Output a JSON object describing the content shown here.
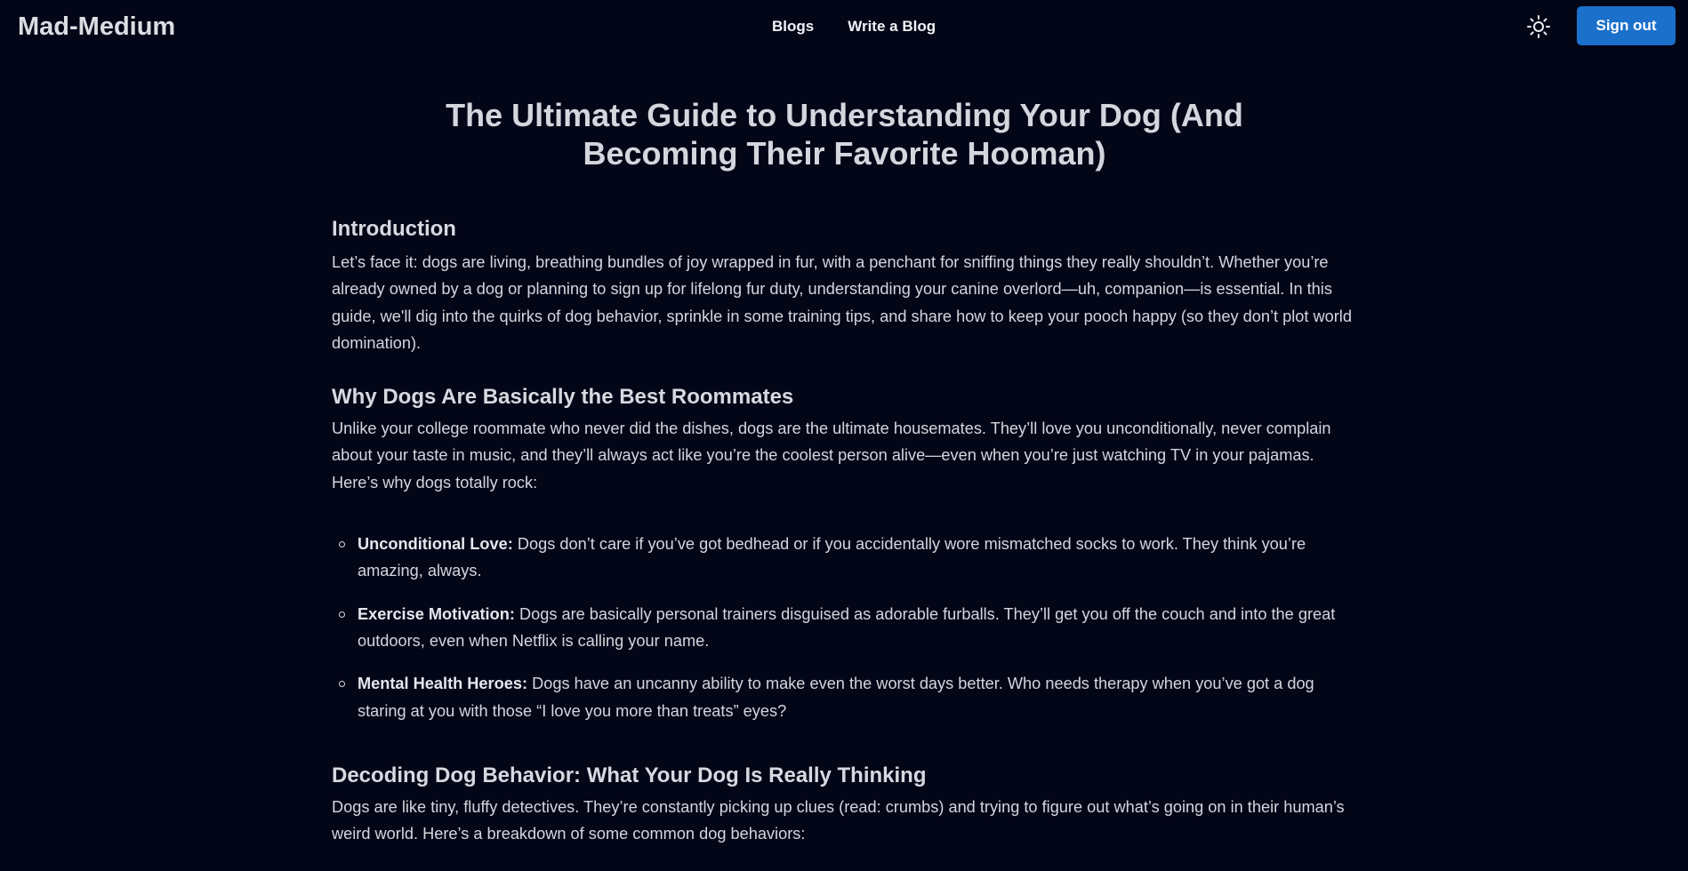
{
  "app": {
    "brand": "Mad-Medium"
  },
  "nav": {
    "links": [
      "Blogs",
      "Write a Blog"
    ],
    "theme_icon": "sun-icon",
    "signout_label": "Sign out"
  },
  "article": {
    "title": "The Ultimate Guide to Understanding Your Dog (And Becoming Their Favorite Hooman)",
    "sections": [
      {
        "heading": "Introduction",
        "paragraph": "Let’s face it: dogs are living, breathing bundles of joy wrapped in fur, with a penchant for sniffing things they really shouldn’t. Whether you’re already owned by a dog or planning to sign up for lifelong fur duty, understanding your canine overlord—uh, companion—is essential. In this guide, we'll dig into the quirks of dog behavior, sprinkle in some training tips, and share how to keep your pooch happy (so they don’t plot world domination)."
      },
      {
        "heading": "Why Dogs Are Basically the Best Roommates",
        "paragraph": "Unlike your college roommate who never did the dishes, dogs are the ultimate housemates. They’ll love you unconditionally, never complain about your taste in music, and they’ll always act like you’re the coolest person alive—even when you’re just watching TV in your pajamas. Here’s why dogs totally rock:",
        "items": [
          {
            "term": "Unconditional Love:",
            "text": "Dogs don’t care if you’ve got bedhead or if you accidentally wore mismatched socks to work. They think you’re amazing, always."
          },
          {
            "term": "Exercise Motivation:",
            "text": "Dogs are basically personal trainers disguised as adorable furballs. They’ll get you off the couch and into the great outdoors, even when Netflix is calling your name."
          },
          {
            "term": "Mental Health Heroes:",
            "text": "Dogs have an uncanny ability to make even the worst days better. Who needs therapy when you’ve got a dog staring at you with those “I love you more than treats” eyes?"
          }
        ]
      },
      {
        "heading": "Decoding Dog Behavior: What Your Dog Is Really Thinking",
        "paragraph": "Dogs are like tiny, fluffy detectives. They’re constantly picking up clues (read: crumbs) and trying to figure out what’s going on in their human’s weird world. Here’s a breakdown of some common dog behaviors:"
      }
    ]
  }
}
